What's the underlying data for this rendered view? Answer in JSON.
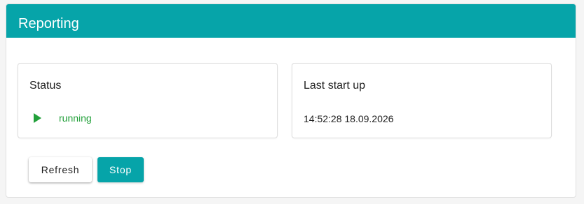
{
  "header": {
    "title": "Reporting"
  },
  "status_card": {
    "title": "Status",
    "status_icon": "play-icon",
    "status_text": "running",
    "status_color": "#22a03a"
  },
  "startup_card": {
    "title": "Last start up",
    "timestamp": "14:52:28 18.09.2026"
  },
  "actions": {
    "refresh_label": "Refresh",
    "stop_label": "Stop"
  },
  "colors": {
    "accent": "#06a4a9"
  }
}
